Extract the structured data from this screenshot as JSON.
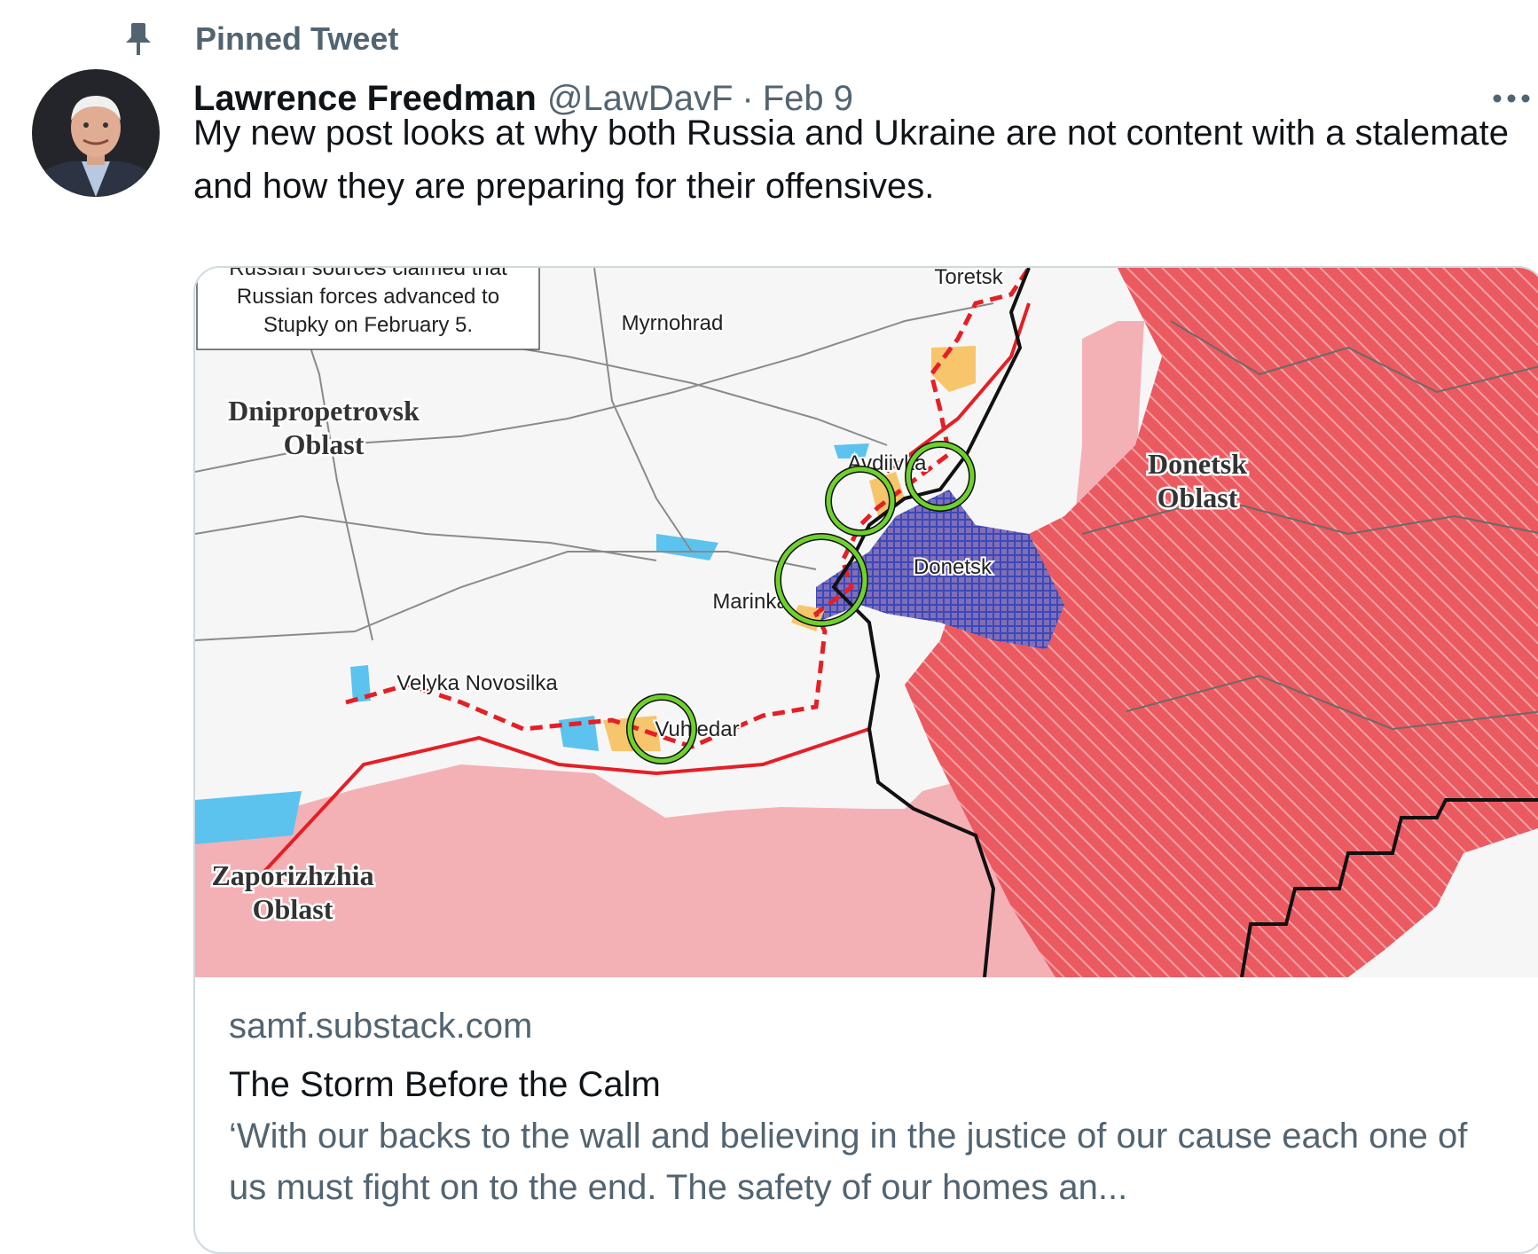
{
  "pinned": {
    "label": "Pinned Tweet"
  },
  "tweet": {
    "author_name": "Lawrence Freedman",
    "handle": "@LawDavF",
    "separator": "·",
    "date": "Feb 9",
    "text": "My new post looks at why both Russia and Ukraine are not content with a stalemate and how they are preparing for their offensives."
  },
  "card": {
    "domain": "samf.substack.com",
    "title": "The Storm Before the Calm",
    "description": "‘With our backs to the wall and believing in the justice of our cause each one of us must fight on to the end. The safety of our homes an..."
  },
  "map": {
    "callout_line1": "Russian sources claimed that",
    "callout_line2": "Russian forces advanced to",
    "callout_line3": "Stupky on February 5.",
    "region_dnipro_1": "Dnipropetrovsk",
    "region_dnipro_2": "Oblast",
    "region_donetsk_1": "Donetsk",
    "region_donetsk_2": "Oblast",
    "region_zapo_1": "Zaporizhzhia",
    "region_zapo_2": "Oblast",
    "city_toretsk": "Toretsk",
    "city_myrnohrad": "Myrnohrad",
    "city_avdiivka": "Avdiivka",
    "city_donetsk": "Donetsk",
    "city_marinka": "Marinka",
    "city_velyka": "Velyka Novosilka",
    "city_vuhledar": "Vuhledar",
    "colors": {
      "occupied": "#f4b1b5",
      "annexed": "#ee6b70",
      "contested": "#f7c56b",
      "circle": "#6ed12c",
      "front": "#e51f25",
      "water": "#5cc3ef"
    }
  }
}
